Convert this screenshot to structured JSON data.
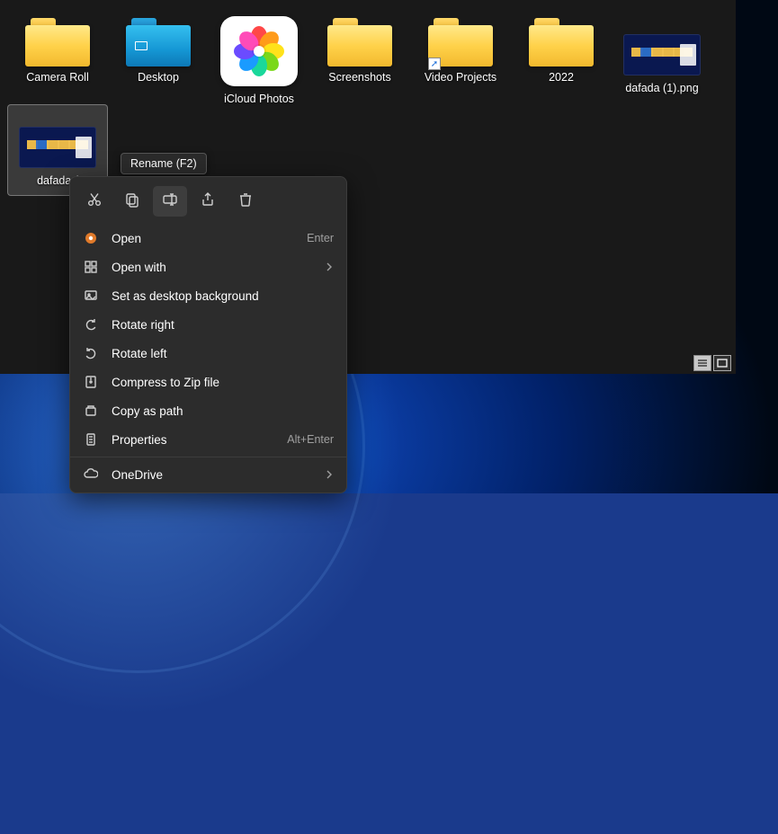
{
  "items": [
    {
      "label": "Camera Roll",
      "type": "folder"
    },
    {
      "label": "Desktop",
      "type": "folder-blue"
    },
    {
      "label": "iCloud Photos",
      "type": "icloud"
    },
    {
      "label": "Screenshots",
      "type": "folder"
    },
    {
      "label": "Video Projects",
      "type": "folder",
      "shortcut": true
    },
    {
      "label": "2022",
      "type": "folder"
    },
    {
      "label": "dafada  (1).png",
      "type": "thumb"
    },
    {
      "label": "dafada  (",
      "type": "thumb",
      "selected": true
    }
  ],
  "tooltip": "Rename (F2)",
  "context_menu": {
    "top": [
      {
        "name": "cut",
        "icon": "cut"
      },
      {
        "name": "copy",
        "icon": "copy"
      },
      {
        "name": "rename",
        "icon": "rename",
        "highlight": true
      },
      {
        "name": "share",
        "icon": "share"
      },
      {
        "name": "delete",
        "icon": "delete"
      }
    ],
    "items": [
      {
        "label": "Open",
        "icon": "open-color",
        "shortcut": "Enter"
      },
      {
        "label": "Open with",
        "icon": "openwith",
        "submenu": true
      },
      {
        "label": "Set as desktop background",
        "icon": "setbg"
      },
      {
        "label": "Rotate right",
        "icon": "rotr"
      },
      {
        "label": "Rotate left",
        "icon": "rotl"
      },
      {
        "label": "Compress to Zip file",
        "icon": "zip"
      },
      {
        "label": "Copy as path",
        "icon": "copypath"
      },
      {
        "label": "Properties",
        "icon": "props",
        "shortcut": "Alt+Enter"
      },
      {
        "divider": true
      },
      {
        "label": "OneDrive",
        "icon": "onedrive",
        "submenu": true
      }
    ]
  },
  "petal_colors": [
    "#ff4848",
    "#ff9b1a",
    "#ffe21a",
    "#7ad81a",
    "#1ad89b",
    "#1a9bff",
    "#6b4bff",
    "#ff4bb8"
  ]
}
